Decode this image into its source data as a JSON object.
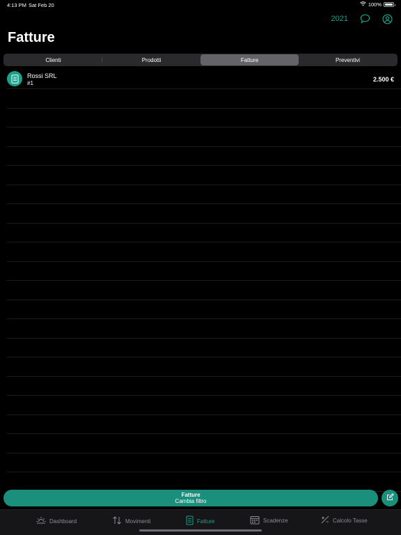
{
  "status_bar": {
    "time": "4:13 PM",
    "date": "Sat Feb 20",
    "battery": "100%"
  },
  "header": {
    "year": "2021",
    "title": "Fatture"
  },
  "segments": [
    {
      "label": "Clienti",
      "active": false
    },
    {
      "label": "Prodotti",
      "active": false
    },
    {
      "label": "Fatture",
      "active": true
    },
    {
      "label": "Preventivi",
      "active": false
    }
  ],
  "invoices": [
    {
      "client": "Rossi SRL",
      "number": "#1",
      "amount": "2.500 €"
    }
  ],
  "filter_button": {
    "title": "Fatture",
    "subtitle": "Cambia filtro"
  },
  "tabs": [
    {
      "label": "Dashboard",
      "icon": "sun-icon",
      "active": false
    },
    {
      "label": "Movimenti",
      "icon": "arrows-up-down-icon",
      "active": false
    },
    {
      "label": "Fatture",
      "icon": "document-icon",
      "active": true
    },
    {
      "label": "Scadenze",
      "icon": "calendar-icon",
      "active": false
    },
    {
      "label": "Calcolo Tasse",
      "icon": "plus-minus-icon",
      "active": false
    }
  ],
  "colors": {
    "accent": "#1ba18a",
    "background": "#000000"
  }
}
